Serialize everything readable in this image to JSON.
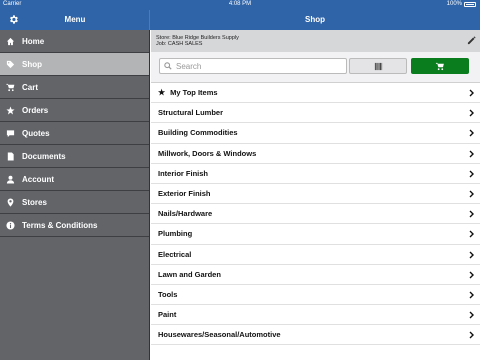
{
  "status": {
    "carrier": "Carrier",
    "time": "4:08 PM",
    "battery": "100%"
  },
  "nav": {
    "menu_title": "Menu",
    "shop_title": "Shop"
  },
  "sidebar": {
    "items": [
      {
        "label": "Home",
        "icon": "home-icon"
      },
      {
        "label": "Shop",
        "icon": "tag-icon",
        "active": true
      },
      {
        "label": "Cart",
        "icon": "cart-icon"
      },
      {
        "label": "Orders",
        "icon": "star-icon"
      },
      {
        "label": "Quotes",
        "icon": "speech-bubble-icon"
      },
      {
        "label": "Documents",
        "icon": "document-icon"
      },
      {
        "label": "Account",
        "icon": "user-icon"
      },
      {
        "label": "Stores",
        "icon": "location-pin-icon"
      },
      {
        "label": "Terms & Conditions",
        "icon": "info-icon"
      }
    ]
  },
  "store": {
    "store_line": "Store: Blue Ridge Builders Supply",
    "job_line": "Job: CASH SALES"
  },
  "search": {
    "placeholder": "Search",
    "value": ""
  },
  "categories": [
    "My Top Items",
    "Structural Lumber",
    "Building Commodities",
    "Millwork, Doors & Windows",
    "Interior Finish",
    "Exterior Finish",
    "Nails/Hardware",
    "Plumbing",
    "Electrical",
    "Lawn and Garden",
    "Tools",
    "Paint",
    "Housewares/Seasonal/Automotive"
  ],
  "colors": {
    "nav": "#2f64a8",
    "sidebar": "#626468",
    "active": "#b3b4b6",
    "cart_button": "#0a7d1e"
  }
}
